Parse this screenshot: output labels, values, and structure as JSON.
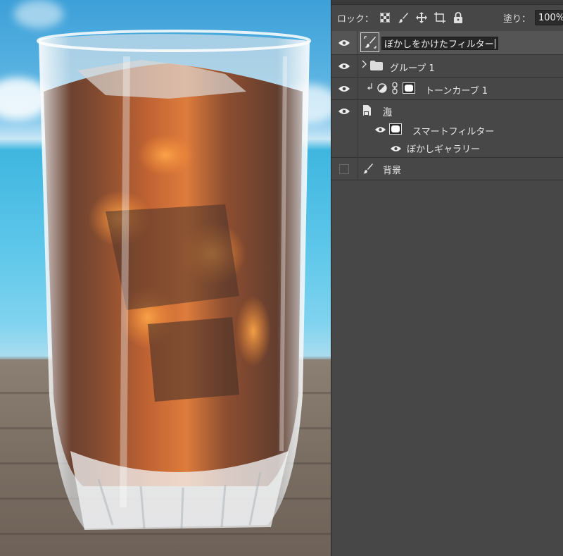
{
  "lock_bar": {
    "label": "ロック：",
    "fill_label": "塗り：",
    "fill_value": "100%"
  },
  "layers": [
    {
      "name": "ぼかしをかけたフィルター",
      "type": "pixel",
      "visible": true,
      "selected": true,
      "editing": true
    },
    {
      "name": "グループ 1",
      "type": "group",
      "visible": true,
      "expanded": false
    },
    {
      "name": "トーンカーブ 1",
      "type": "adjustment",
      "visible": true,
      "clipped": true
    },
    {
      "name": "海",
      "type": "smart-object",
      "visible": true,
      "smart_filters": {
        "label": "スマートフィルター",
        "items": [
          "ぼかしギャラリー"
        ]
      }
    },
    {
      "name": "背景",
      "type": "background",
      "visible": false
    }
  ],
  "colors": {
    "panel_bg": "#474747",
    "selected_row": "#555555",
    "text": "#e6e6e6"
  }
}
